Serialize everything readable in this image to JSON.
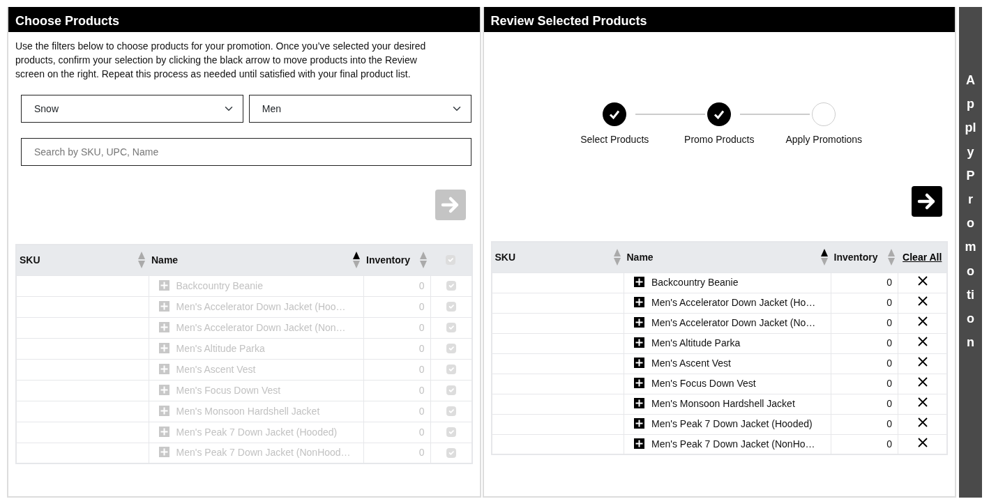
{
  "choose_panel": {
    "title": "Choose Products",
    "instructions": "Use the filters below to choose products for your promotion. Once you’ve selected your desired products, confirm your selection by clicking the black arrow to move products into the Review screen on the right. Repeat this process as needed until satisfied with your final product list.",
    "filters": [
      {
        "value": "Snow"
      },
      {
        "value": "Men"
      }
    ],
    "search": {
      "placeholder": "Search by SKU, UPC, Name"
    },
    "move_button": {
      "disabled": true
    },
    "table": {
      "columns": [
        {
          "label": "SKU",
          "sorted": false
        },
        {
          "label": "Name",
          "sorted": true
        },
        {
          "label": "Inventory",
          "sorted": false
        }
      ],
      "header_checkbox": {
        "checked": true,
        "disabled": true
      },
      "rows": [
        {
          "sku": "",
          "name": "Backcountry Beanie",
          "inventory": "0",
          "checked": true,
          "disabled": true
        },
        {
          "sku": "",
          "name": "Men's Accelerator Down Jacket (Hoo…",
          "inventory": "0",
          "checked": true,
          "disabled": true
        },
        {
          "sku": "",
          "name": "Men's Accelerator Down Jacket (Non…",
          "inventory": "0",
          "checked": true,
          "disabled": true
        },
        {
          "sku": "",
          "name": "Men's Altitude Parka",
          "inventory": "0",
          "checked": true,
          "disabled": true
        },
        {
          "sku": "",
          "name": "Men's Ascent Vest",
          "inventory": "0",
          "checked": true,
          "disabled": true
        },
        {
          "sku": "",
          "name": "Men's Focus Down Vest",
          "inventory": "0",
          "checked": true,
          "disabled": true
        },
        {
          "sku": "",
          "name": "Men's Monsoon Hardshell Jacket",
          "inventory": "0",
          "checked": true,
          "disabled": true
        },
        {
          "sku": "",
          "name": "Men's Peak 7 Down Jacket (Hooded)",
          "inventory": "0",
          "checked": true,
          "disabled": true
        },
        {
          "sku": "",
          "name": "Men's Peak 7 Down Jacket (NonHood…",
          "inventory": "0",
          "checked": true,
          "disabled": true
        }
      ]
    }
  },
  "review_panel": {
    "title": "Review Selected Products",
    "steps": [
      {
        "label": "Select Products",
        "done": true
      },
      {
        "label": "Promo Products",
        "done": true
      },
      {
        "label": "Apply Promotions",
        "done": false
      }
    ],
    "move_button": {
      "disabled": false
    },
    "table": {
      "columns": [
        {
          "label": "SKU",
          "sorted": false
        },
        {
          "label": "Name",
          "sorted": true
        },
        {
          "label": "Inventory",
          "sorted": false
        }
      ],
      "clear_all": "Clear All",
      "rows": [
        {
          "sku": "",
          "name": "Backcountry Beanie",
          "inventory": "0"
        },
        {
          "sku": "",
          "name": "Men's Accelerator Down Jacket (Ho…",
          "inventory": "0"
        },
        {
          "sku": "",
          "name": "Men's Accelerator Down Jacket (No…",
          "inventory": "0"
        },
        {
          "sku": "",
          "name": "Men's Altitude Parka",
          "inventory": "0"
        },
        {
          "sku": "",
          "name": "Men's Ascent Vest",
          "inventory": "0"
        },
        {
          "sku": "",
          "name": "Men's Focus Down Vest",
          "inventory": "0"
        },
        {
          "sku": "",
          "name": "Men's Monsoon Hardshell Jacket",
          "inventory": "0"
        },
        {
          "sku": "",
          "name": "Men's Peak 7 Down Jacket (Hooded)",
          "inventory": "0"
        },
        {
          "sku": "",
          "name": "Men's Peak 7 Down Jacket (NonHo…",
          "inventory": "0"
        }
      ]
    }
  },
  "side_button": {
    "label": "Apply Promotion"
  }
}
